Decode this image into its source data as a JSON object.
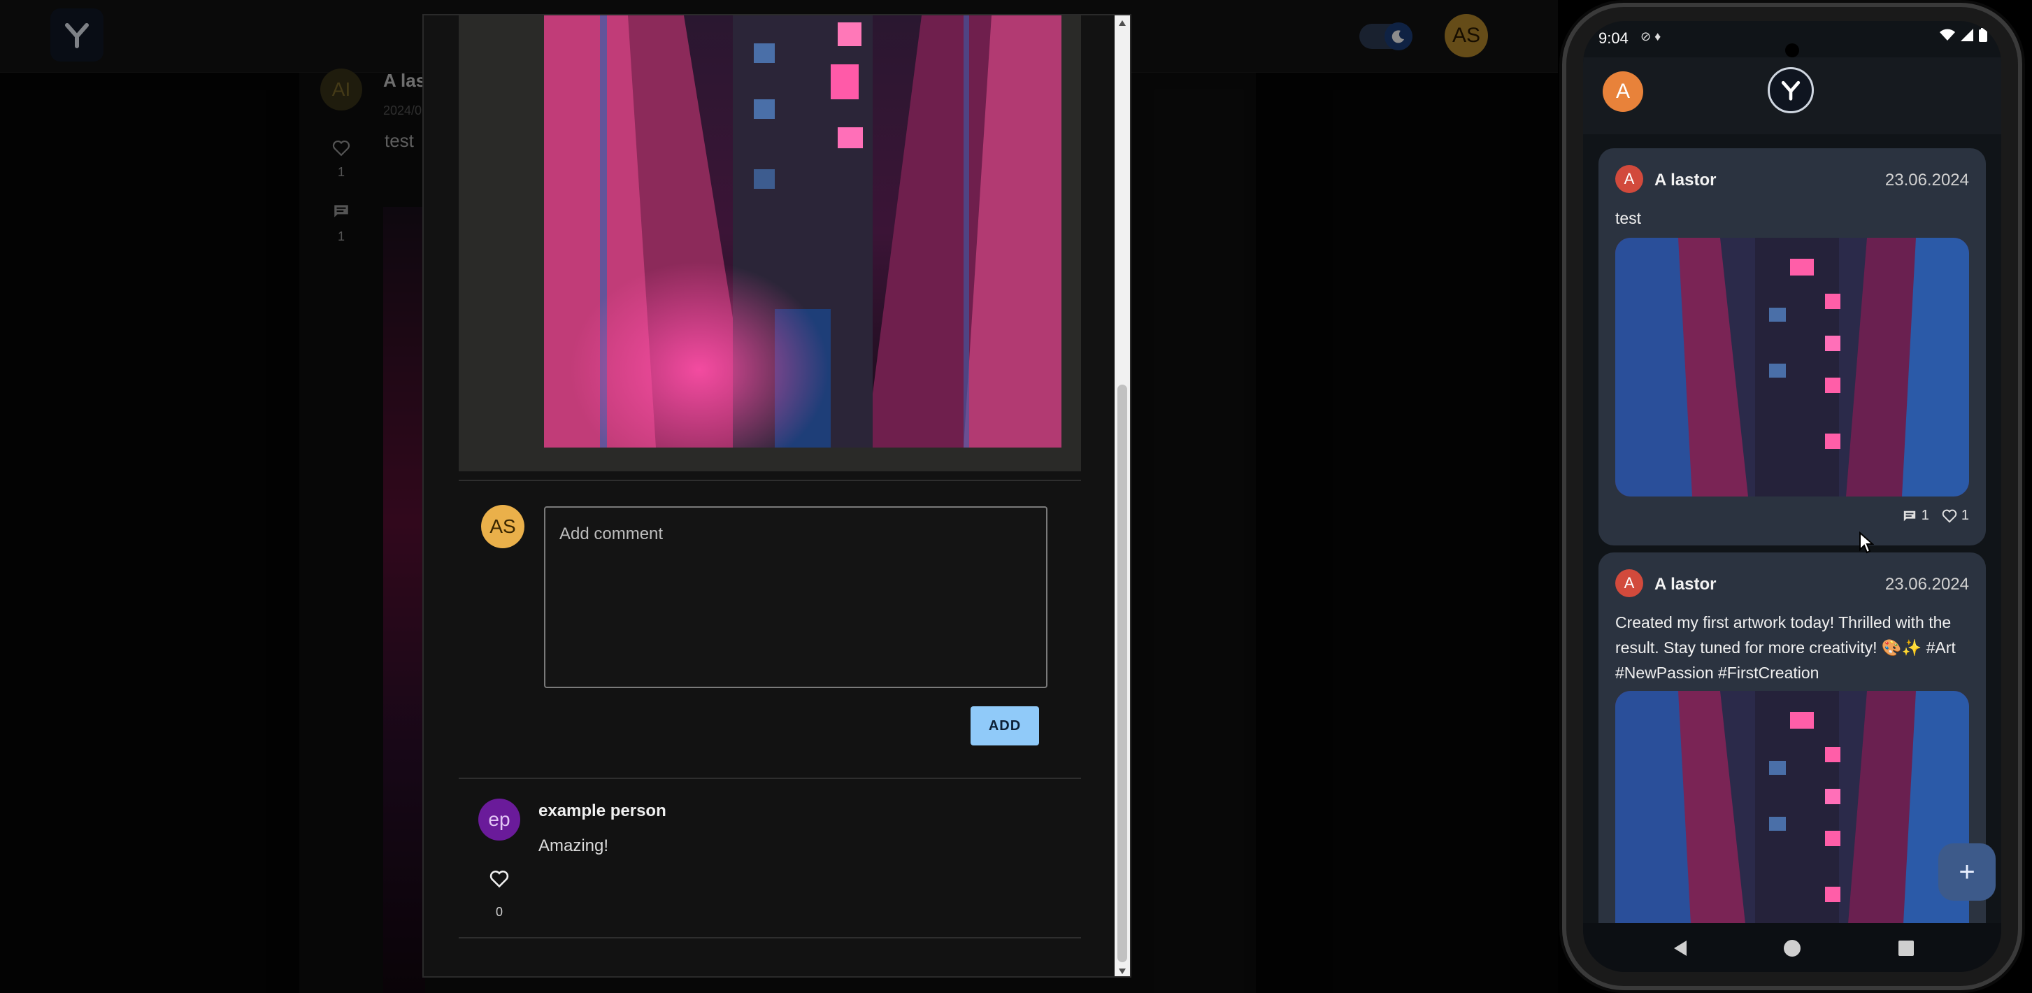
{
  "web": {
    "header": {
      "user_initials": "AS"
    },
    "bg_post": {
      "avatar_initials": "AI",
      "author": "A las",
      "date": "2024/0",
      "text": "test",
      "likes": "1",
      "comments": "1"
    }
  },
  "dialog": {
    "current_user_initials": "AS",
    "comment_placeholder": "Add comment",
    "add_button": "ADD",
    "comments": [
      {
        "avatar_initials": "ep",
        "author": "example person",
        "text": "Amazing!",
        "likes": "0"
      }
    ]
  },
  "phone": {
    "status_time": "9:04",
    "user_initial": "A",
    "posts": [
      {
        "avatar_initial": "A",
        "author": "A lastor",
        "date": "23.06.2024",
        "text": "test",
        "comments": "1",
        "likes": "1"
      },
      {
        "avatar_initial": "A",
        "author": "A lastor",
        "date": "23.06.2024",
        "text": "Created my first artwork today! Thrilled with the result. Stay tuned for more creativity! 🎨✨ #Art #NewPassion #FirstCreation"
      }
    ],
    "fab_label": "+"
  },
  "colors": {
    "accent": "#90caf9",
    "user_avatar": "#eab04a",
    "commenter_avatar": "#6a1b9a",
    "phone_card": "#2b3340"
  }
}
